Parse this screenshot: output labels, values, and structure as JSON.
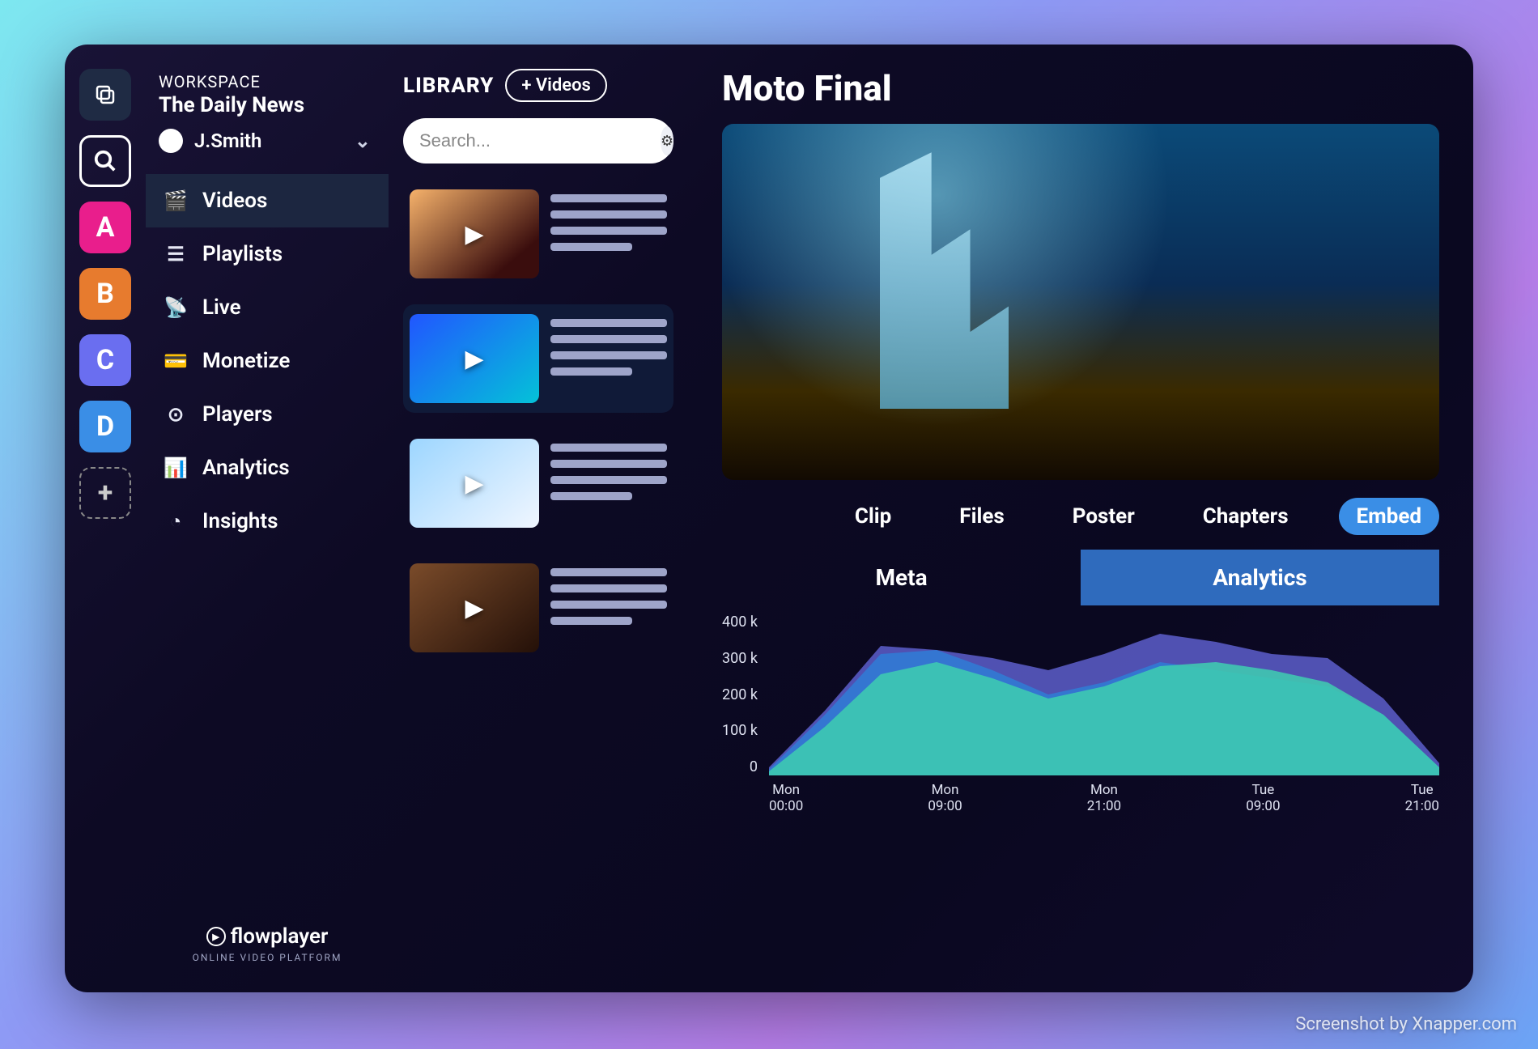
{
  "rail": {
    "letters": [
      "A",
      "B",
      "C",
      "D"
    ],
    "colors": {
      "a": "#e91e8c",
      "b": "#e77b2e",
      "c": "#6a6ef0",
      "d": "#3a8ee6"
    }
  },
  "workspace": {
    "eyebrow": "WORKSPACE",
    "name": "The Daily News",
    "user": "J.Smith"
  },
  "nav": {
    "items": [
      {
        "label": "Videos",
        "icon": "clapper-icon",
        "active": true
      },
      {
        "label": "Playlists",
        "icon": "list-icon"
      },
      {
        "label": "Live",
        "icon": "live-icon"
      },
      {
        "label": "Monetize",
        "icon": "wallet-icon"
      },
      {
        "label": "Players",
        "icon": "play-circle-icon"
      },
      {
        "label": "Analytics",
        "icon": "chart-icon"
      },
      {
        "label": "Insights",
        "icon": "pie-icon"
      }
    ]
  },
  "brand": {
    "name": "flowplayer",
    "subtitle": "ONLINE VIDEO PLATFORM"
  },
  "library": {
    "title": "LIBRARY",
    "add_button": "+ Videos",
    "search_placeholder": "Search...",
    "items": [
      {
        "thumb": "thumb-1",
        "selected": false
      },
      {
        "thumb": "thumb-2",
        "selected": true
      },
      {
        "thumb": "thumb-3",
        "selected": false
      },
      {
        "thumb": "thumb-4",
        "selected": false
      }
    ]
  },
  "main": {
    "title": "Moto Final",
    "tabs": [
      "Clip",
      "Files",
      "Poster",
      "Chapters",
      "Embed"
    ],
    "active_tab": "Embed",
    "panel_tabs": [
      "Meta",
      "Analytics"
    ],
    "active_panel": "Analytics"
  },
  "chart_data": {
    "type": "area",
    "title": "",
    "xlabel": "",
    "ylabel": "",
    "ylim": [
      0,
      400000
    ],
    "yticks": [
      "400 k",
      "300 k",
      "200 k",
      "100 k",
      "0"
    ],
    "x_tick_labels": [
      "Mon\n00:00",
      "Mon\n09:00",
      "Mon\n21:00",
      "Tue\n09:00",
      "Tue\n21:00"
    ],
    "x": [
      0,
      1,
      2,
      3,
      4,
      5,
      6,
      7,
      8,
      9,
      10,
      11,
      12
    ],
    "series": [
      {
        "name": "series-back",
        "color": "#5d5ecb",
        "values": [
          20000,
          160000,
          320000,
          310000,
          290000,
          260000,
          300000,
          350000,
          330000,
          300000,
          290000,
          190000,
          30000
        ]
      },
      {
        "name": "series-mid",
        "color": "#2f7dd6",
        "values": [
          15000,
          150000,
          300000,
          310000,
          260000,
          200000,
          230000,
          280000,
          260000,
          240000,
          220000,
          150000,
          20000
        ]
      },
      {
        "name": "series-front",
        "color": "#3ecfb0",
        "values": [
          10000,
          120000,
          250000,
          280000,
          240000,
          190000,
          220000,
          270000,
          280000,
          260000,
          230000,
          150000,
          20000
        ]
      }
    ]
  },
  "watermark": "Screenshot by Xnapper.com"
}
